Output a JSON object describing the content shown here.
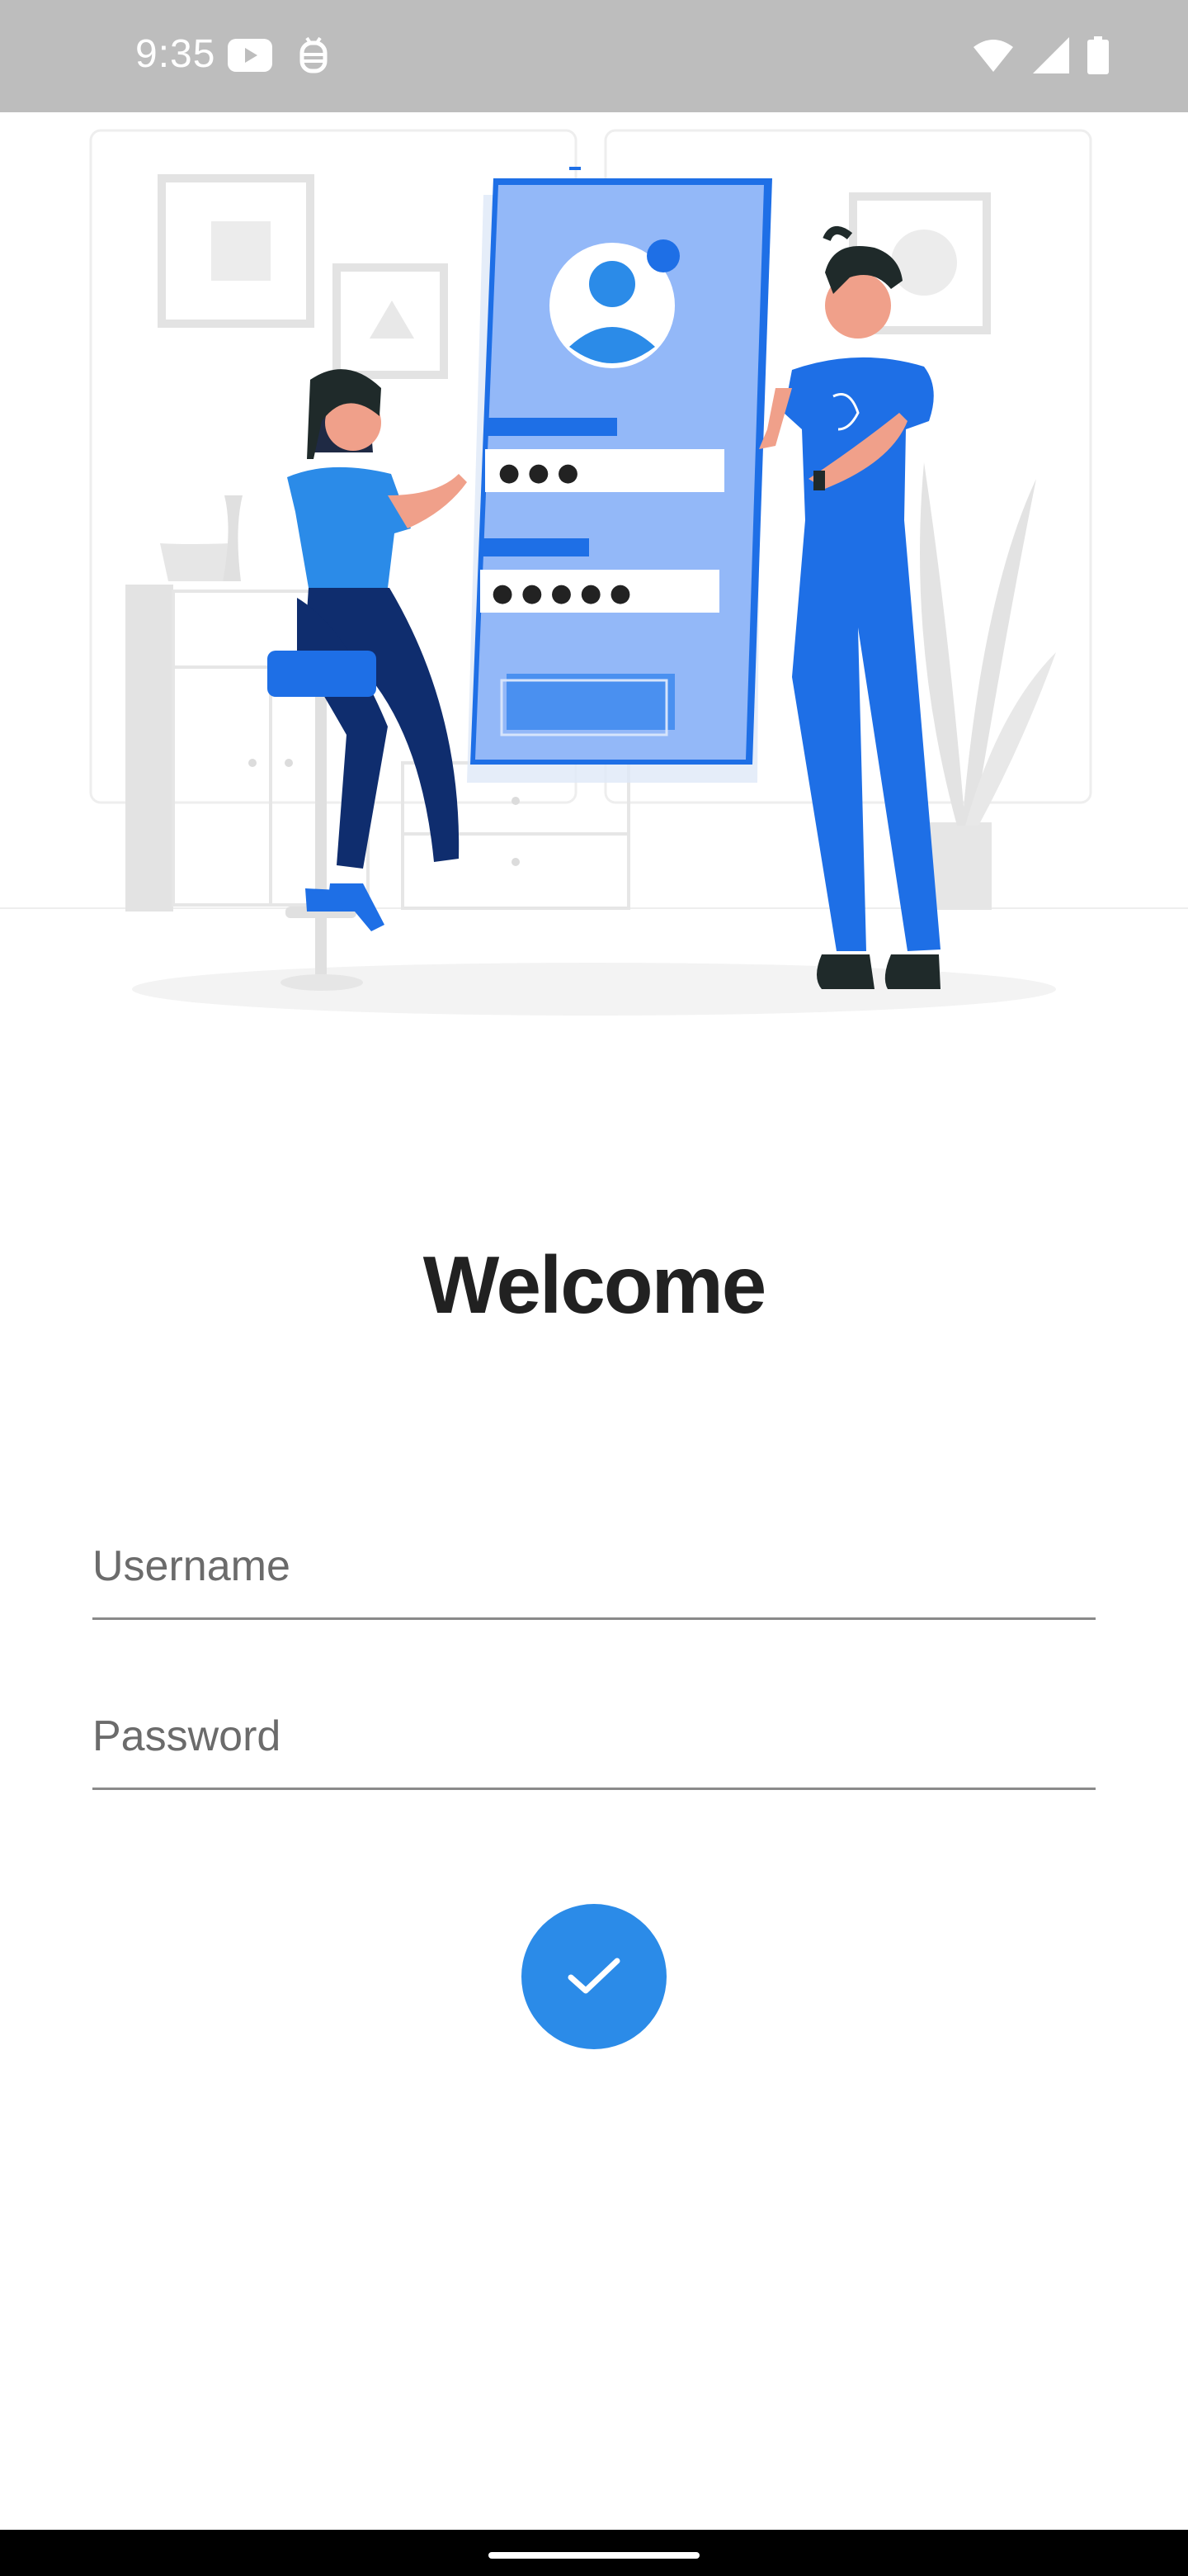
{
  "status_bar": {
    "time": "9:35",
    "left_icons": [
      "youtube-icon",
      "debug-icon"
    ],
    "right_icons": [
      "wifi-icon",
      "signal-icon",
      "battery-icon"
    ]
  },
  "illustration": {
    "login_card": {
      "password_dots_1": "● ● ●",
      "password_dots_2": "● ● ● ● ●"
    }
  },
  "login": {
    "title": "Welcome",
    "username_placeholder": "Username",
    "password_placeholder": "Password",
    "submit_icon": "check-icon"
  },
  "colors": {
    "accent": "#2b8be8",
    "illustration_blue": "#1e6fe6",
    "status_bar": "#bdbdbd"
  }
}
